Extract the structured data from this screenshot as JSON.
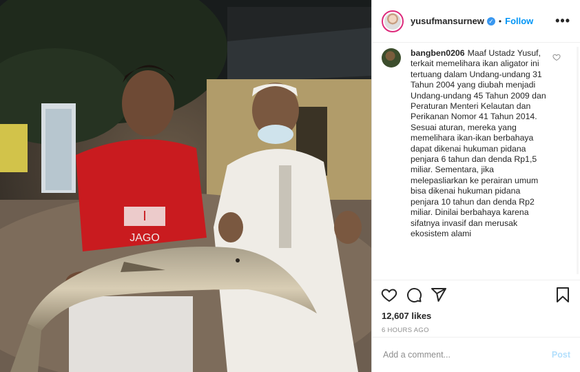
{
  "header": {
    "username": "yusufmansurnew",
    "verified_icon": "verified-badge-icon",
    "separator": "•",
    "follow_label": "Follow",
    "more_icon": "more-options-icon",
    "more_label": "•••"
  },
  "photo": {
    "shirt_text_top": "I",
    "shirt_text_bottom": "JAGO"
  },
  "comment": {
    "username": "bangben0206",
    "text": "Maaf Ustadz Yusuf, terkait memelihara ikan aligator ini tertuang dalam Undang-undang 31 Tahun 2004 yang diubah menjadi Undang-undang 45 Tahun 2009 dan Peraturan Menteri Kelautan dan Perikanan Nomor 41 Tahun 2014. Sesuai aturan, mereka yang memelihara ikan-ikan berbahaya dapat dikenai hukuman pidana penjara 6 tahun dan denda Rp1,5 miliar. Sementara, jika melepasliarkan ke perairan umum bisa dikenai hukuman pidana penjara 10 tahun dan denda Rp2 miliar. Dinilai berbahaya karena sifatnya invasif dan merusak ekosistem alami"
  },
  "actions": {
    "like_icon": "heart-icon",
    "comment_icon": "comment-icon",
    "share_icon": "share-icon",
    "save_icon": "bookmark-icon"
  },
  "likes": "12,607 likes",
  "timestamp": "6 HOURS AGO",
  "add_comment": {
    "placeholder": "Add a comment...",
    "post_label": "Post"
  },
  "colors": {
    "accent": "#0095f6",
    "verified": "#3897f0",
    "post_disabled": "#b2dffc"
  }
}
